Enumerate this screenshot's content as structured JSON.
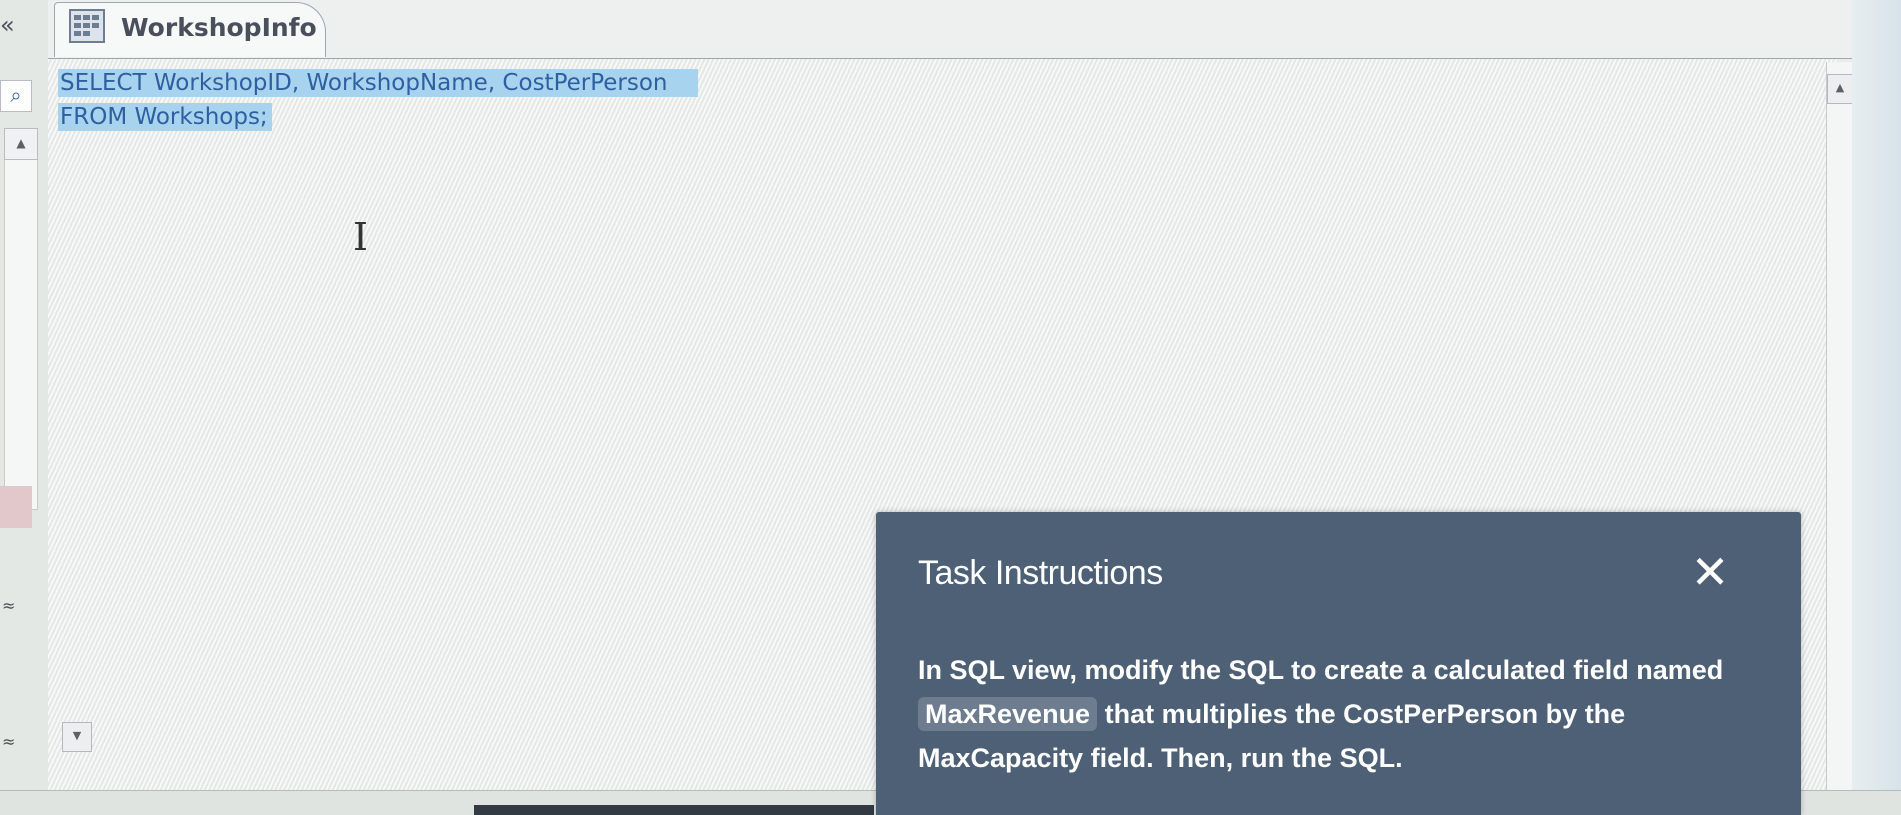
{
  "tab": {
    "title": "WorkshopInfo",
    "icon": "table-query-icon",
    "close_glyph": "✕"
  },
  "nav": {
    "collapse_glyph": "«",
    "search_glyph": "⌕",
    "scroll_up_glyph": "▲",
    "chevron_glyph": "≈"
  },
  "editor": {
    "sql_lines": [
      "SELECT WorkshopID, WorkshopName, CostPerPerson",
      "FROM Workshops;"
    ],
    "cursor_glyph": "I",
    "selection_color": "#a8d3ee",
    "text_color": "#2d5fa1"
  },
  "scrollbar": {
    "up_glyph": "▲",
    "down_glyph": "▼"
  },
  "task": {
    "title": "Task Instructions",
    "close_glyph": "✕",
    "text_part1": "In SQL view, modify the SQL to create a calculated field named",
    "field_name": "MaxRevenue",
    "text_part2": "that multiplies the CostPerPerson by the MaxCapacity field. Then, run the SQL.",
    "panel_color": "#4e6076"
  }
}
